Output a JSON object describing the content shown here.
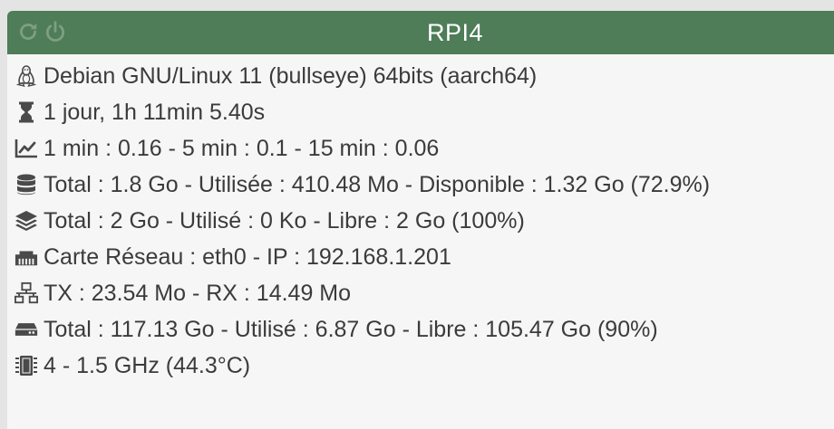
{
  "title_bar": {
    "title": "RPI4",
    "color": "#4e7d57",
    "actions": [
      {
        "name": "refresh-icon"
      },
      {
        "name": "power-icon"
      }
    ]
  },
  "rows": {
    "os": {
      "icon": "linux-penguin-icon",
      "text": "Debian GNU/Linux 11 (bullseye) 64bits (aarch64)"
    },
    "uptime": {
      "icon": "hourglass-icon",
      "text": "1 jour, 1h 11min 5.40s"
    },
    "load": {
      "icon": "chart-line-icon",
      "text": "1 min : 0.16 - 5 min : 0.1 - 15 min : 0.06"
    },
    "memory": {
      "icon": "database-icon",
      "text": "Total : 1.8 Go - Utilisée : 410.48 Mo - Disponible : 1.32 Go (72.9%)"
    },
    "swap": {
      "icon": "layers-icon",
      "text": "Total : 2 Go - Utilisé : 0 Ko - Libre : 2 Go (100%)"
    },
    "network_card": {
      "icon": "ethernet-port-icon",
      "text": "Carte Réseau : eth0 - IP : 192.168.1.201"
    },
    "traffic": {
      "icon": "network-icon",
      "text": "TX : 23.54 Mo - RX : 14.49 Mo"
    },
    "disk": {
      "icon": "hard-drive-icon",
      "text": "Total : 117.13 Go - Utilisé : 6.87 Go - Libre : 105.47 Go (90%)"
    },
    "cpu": {
      "icon": "cpu-chip-icon",
      "text": "4 - 1.5 GHz (44.3°C)"
    }
  }
}
